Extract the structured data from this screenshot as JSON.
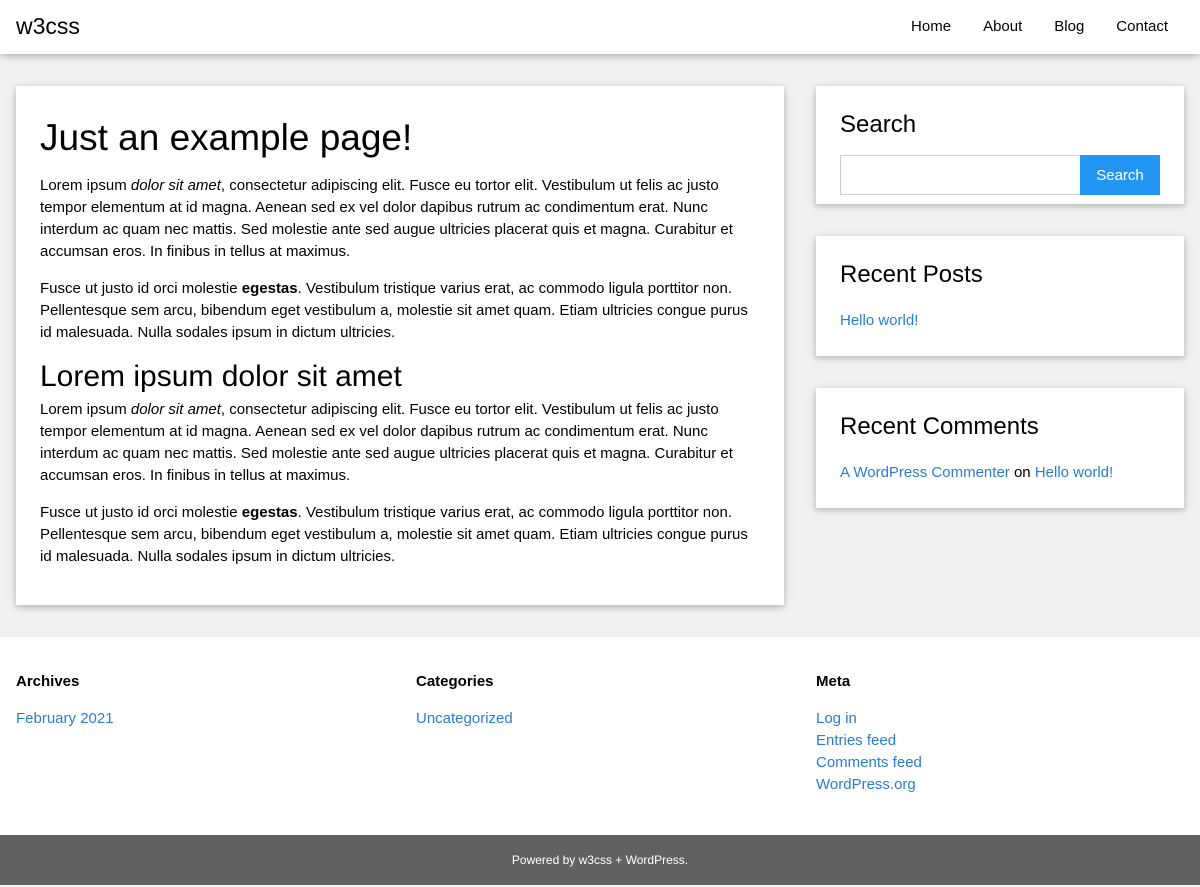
{
  "header": {
    "brand": "w3css",
    "nav": [
      "Home",
      "About",
      "Blog",
      "Contact"
    ]
  },
  "main": {
    "title": "Just an example page!",
    "p1": {
      "pre": "Lorem ipsum ",
      "em": "dolor sit amet",
      "post": ", consectetur adipiscing elit. Fusce eu tortor elit. Vestibulum ut felis ac justo tempor elementum at id magna. Aenean sed ex vel dolor dapibus rutrum ac condimentum erat. Nunc interdum ac quam nec mattis. Sed molestie ante sed augue ultricies placerat quis et magna. Curabitur et accumsan eros. In finibus in tellus at maximus."
    },
    "p2": {
      "pre": "Fusce ut justo id orci molestie ",
      "strong": "egestas",
      "post": ". Vestibulum tristique varius erat, ac commodo ligula porttitor non. Pellentesque sem arcu, bibendum eget vestibulum a, molestie sit amet quam. Etiam ultricies congue purus id malesuada. Nulla sodales ipsum in dictum ultricies."
    },
    "subtitle": "Lorem ipsum dolor sit amet",
    "p3": {
      "pre": "Lorem ipsum ",
      "em": "dolor sit amet",
      "post": ", consectetur adipiscing elit. Fusce eu tortor elit. Vestibulum ut felis ac justo tempor elementum at id magna. Aenean sed ex vel dolor dapibus rutrum ac condimentum erat. Nunc interdum ac quam nec mattis. Sed molestie ante sed augue ultricies placerat quis et magna. Curabitur et accumsan eros. In finibus in tellus at maximus."
    },
    "p4": {
      "pre": "Fusce ut justo id orci molestie ",
      "strong": "egestas",
      "post": ". Vestibulum tristique varius erat, ac commodo ligula porttitor non. Pellentesque sem arcu, bibendum eget vestibulum a, molestie sit amet quam. Etiam ultricies congue purus id malesuada. Nulla sodales ipsum in dictum ultricies."
    }
  },
  "sidebar": {
    "search": {
      "title": "Search",
      "input_value": "",
      "button_label": "Search"
    },
    "recent_posts": {
      "title": "Recent Posts",
      "items": [
        "Hello world!"
      ]
    },
    "recent_comments": {
      "title": "Recent Comments",
      "author": "A WordPress Commenter",
      "connector": " on ",
      "post": "Hello world!"
    }
  },
  "footer": {
    "archives": {
      "title": "Archives",
      "items": [
        "February 2021"
      ]
    },
    "categories": {
      "title": "Categories",
      "items": [
        "Uncategorized"
      ]
    },
    "meta": {
      "title": "Meta",
      "items": [
        "Log in",
        "Entries feed",
        "Comments feed",
        "WordPress.org"
      ]
    },
    "credit": "Powered by w3css + WordPress."
  },
  "colors": {
    "link": "#2a7ed0",
    "button": "#2196f3",
    "bottom_bar": "#616161",
    "background": "#f1f1f1"
  }
}
